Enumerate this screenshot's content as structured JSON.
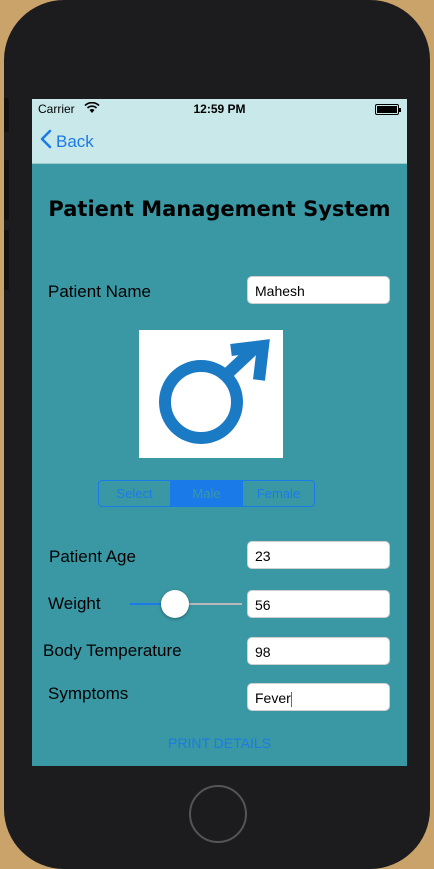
{
  "status_bar": {
    "carrier": "Carrier",
    "time": "12:59 PM"
  },
  "nav": {
    "back_label": "Back"
  },
  "title": "Patient Management System",
  "form": {
    "name_label": "Patient Name",
    "name_value": "Mahesh",
    "gender_options": [
      "Select",
      "Male",
      "Female"
    ],
    "gender_selected": "Male",
    "age_label": "Patient Age",
    "age_value": "23",
    "weight_label": "Weight",
    "weight_value": "56",
    "weight_slider_fraction": 0.4,
    "temp_label": "Body Temperature",
    "temp_value": "98",
    "symptoms_label": "Symptoms",
    "symptoms_value": "Fever"
  },
  "print_button_label": "PRINT DETAILS",
  "colors": {
    "screen_bg": "#3a98a4",
    "nav_bg": "#c9e8ea",
    "accent": "#1a7ae8",
    "male_symbol": "#1a7ac4"
  },
  "icons": {
    "back": "chevron-left-icon",
    "gender": "male-symbol-icon"
  }
}
